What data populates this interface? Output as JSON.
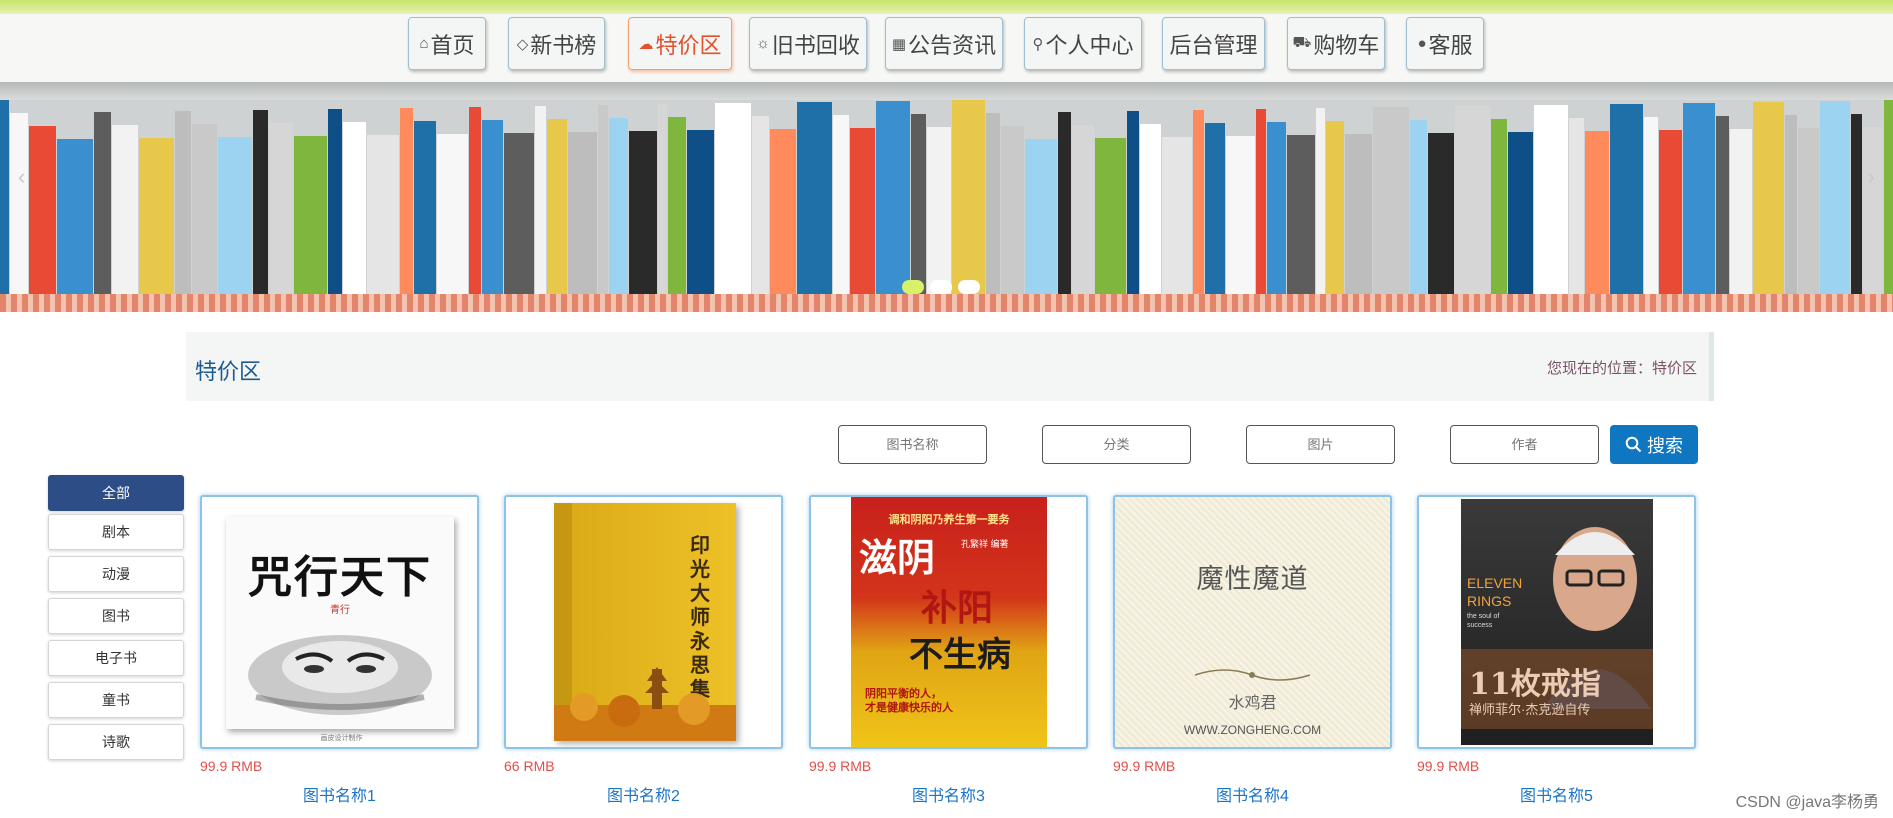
{
  "nav": {
    "items": [
      {
        "label": "首页",
        "icon": "home-icon",
        "glyph": "⌂"
      },
      {
        "label": "新书榜",
        "icon": "tag-icon",
        "glyph": "◇"
      },
      {
        "label": "特价区",
        "icon": "cloud-icon",
        "glyph": "☁"
      },
      {
        "label": "旧书回收",
        "icon": "sun-icon",
        "glyph": "☼"
      },
      {
        "label": "公告资讯",
        "icon": "grid-icon",
        "glyph": "▦"
      },
      {
        "label": "个人中心",
        "icon": "user-icon",
        "glyph": "⚲"
      },
      {
        "label": "后台管理",
        "icon": "",
        "glyph": ""
      },
      {
        "label": "购物车",
        "icon": "cart-icon",
        "glyph": "⛟"
      },
      {
        "label": "客服",
        "icon": "support-icon",
        "glyph": "●"
      }
    ],
    "active_index": 2,
    "active_color": "#e2512b"
  },
  "banner": {
    "prev_glyph": "‹",
    "next_glyph": "›",
    "slide_count": 3,
    "active_slide": 0
  },
  "page": {
    "title": "特价区",
    "location_label": "您现在的位置：特价区"
  },
  "search": {
    "fields": [
      {
        "placeholder": "图书名称"
      },
      {
        "placeholder": "分类"
      },
      {
        "placeholder": "图片"
      },
      {
        "placeholder": "作者"
      }
    ],
    "button_label": "搜索",
    "button_color": "#0f76c2"
  },
  "categories": {
    "items": [
      "全部",
      "剧本",
      "动漫",
      "图书",
      "电子书",
      "童书",
      "诗歌"
    ],
    "active_index": 0,
    "active_color": "#2d4d86"
  },
  "books": [
    {
      "name": "图书名称1",
      "price": "99.9 RMB",
      "cover": {
        "title": "咒行天下",
        "author": "青行",
        "footer": "画皮设计制作"
      }
    },
    {
      "name": "图书名称2",
      "price": "66 RMB",
      "cover": {
        "title": "印光大师永思集"
      }
    },
    {
      "name": "图书名称3",
      "price": "99.9 RMB",
      "cover": {
        "top": "调和阴阳乃养生第一要务",
        "title1": "滋阴",
        "title2": "补阳",
        "title3": "不生病",
        "sub1": "阴阳平衡的人，",
        "sub2": "才是健康快乐的人",
        "author": "孔繁祥 编著"
      }
    },
    {
      "name": "图书名称4",
      "price": "99.9 RMB",
      "cover": {
        "title": "魔性魔道",
        "author": "水鸡君",
        "url": "WWW.ZONGHENG.COM"
      }
    },
    {
      "name": "图书名称5",
      "price": "99.9 RMB",
      "cover": {
        "en1": "ELEVEN",
        "en2": "RINGS",
        "en3": "the soul of",
        "en4": "success",
        "title": "11枚戒指",
        "sub": "禅师菲尔·杰克逊自传"
      }
    }
  ],
  "watermark": "CSDN @java李杨勇"
}
